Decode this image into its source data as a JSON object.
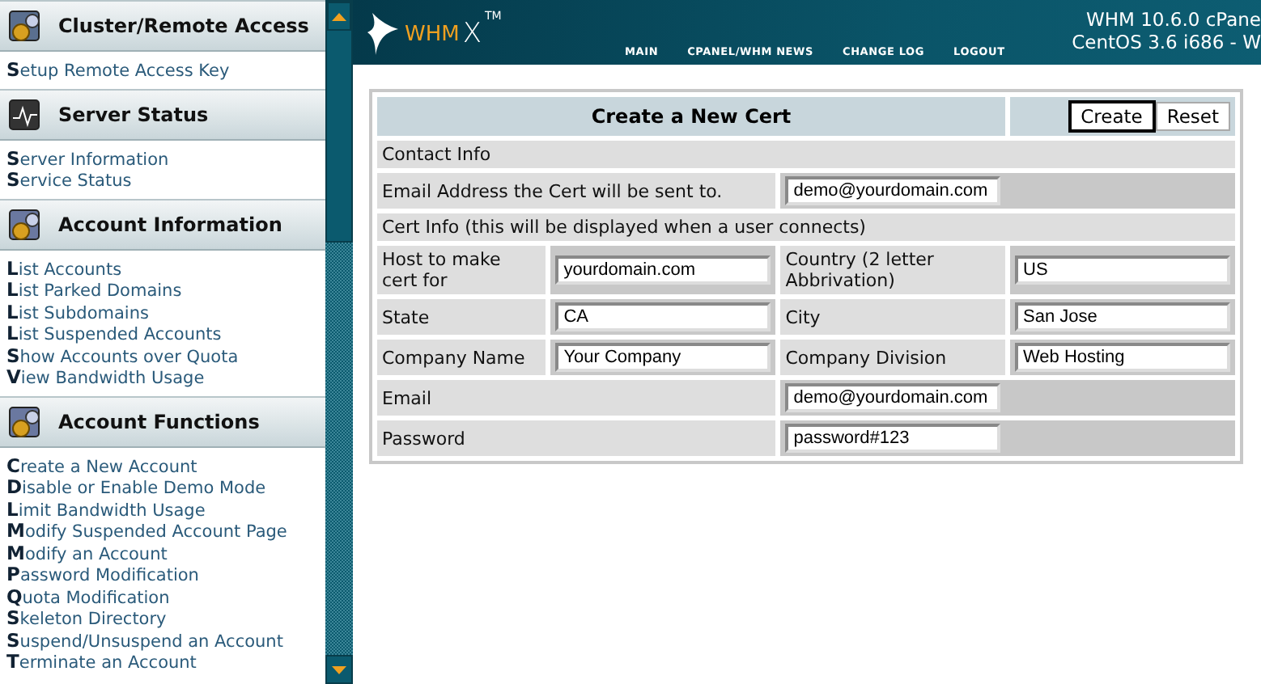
{
  "sidebar": {
    "sections": [
      {
        "kind": "cluster",
        "title": "Cluster/Remote Access",
        "links": [
          "**S**etup Remote Access Key"
        ]
      },
      {
        "kind": "server",
        "title": "Server Status",
        "links": [
          "**S**erver Information",
          "**S**ervice Status"
        ]
      },
      {
        "kind": "info",
        "title": "Account Information",
        "links": [
          "**L**ist Accounts",
          "**L**ist Parked Domains",
          "**L**ist Subdomains",
          "**L**ist Suspended Accounts",
          "**S**how Accounts over Quota",
          "**V**iew Bandwidth Usage"
        ]
      },
      {
        "kind": "functions",
        "title": "Account Functions",
        "links": [
          "**C**reate a New Account",
          "**D**isable or Enable Demo Mode",
          "**L**imit Bandwidth Usage",
          "**M**odify Suspended Account Page",
          "**M**odify an Account",
          "**P**assword Modification",
          "**Q**uota Modification",
          "**S**keleton Directory",
          "**S**uspend/Unsuspend an Account",
          "**T**erminate an Account"
        ]
      }
    ]
  },
  "header": {
    "logo": "WHM",
    "logo_x": "X",
    "logo_tm": "TM",
    "nav": [
      "MAIN",
      "CPANEL/WHM NEWS",
      "CHANGE LOG",
      "LOGOUT"
    ],
    "version_lines": [
      "WHM 10.6.0 cPane",
      "CentOS 3.6 i686 - W"
    ]
  },
  "form": {
    "title": "Create a New Cert",
    "buttons": [
      {
        "label": "Create",
        "focused": true
      },
      {
        "label": "Reset",
        "focused": false
      }
    ],
    "rows": [
      {
        "kind": "section",
        "label": "Contact Info"
      },
      {
        "kind": "wide",
        "label": "Email Address the Cert will be sent to.",
        "value": "demo@yourdomain.com"
      },
      {
        "kind": "section",
        "label": "Cert Info (this will be displayed when a user connects)"
      },
      {
        "kind": "pair",
        "cells": [
          {
            "label": "Host to make cert for",
            "value": "yourdomain.com"
          },
          {
            "label": "Country (2 letter Abbrivation)",
            "value": "US"
          }
        ]
      },
      {
        "kind": "pair",
        "cells": [
          {
            "label": "State",
            "value": "CA"
          },
          {
            "label": "City",
            "value": "San Jose"
          }
        ]
      },
      {
        "kind": "pair",
        "cells": [
          {
            "label": "Company Name",
            "value": "Your Company"
          },
          {
            "label": "Company Division",
            "value": "Web Hosting"
          }
        ]
      },
      {
        "kind": "wide",
        "label": "Email",
        "value": "demo@yourdomain.com"
      },
      {
        "kind": "wide",
        "label": "Password",
        "value": "password#123"
      }
    ]
  }
}
